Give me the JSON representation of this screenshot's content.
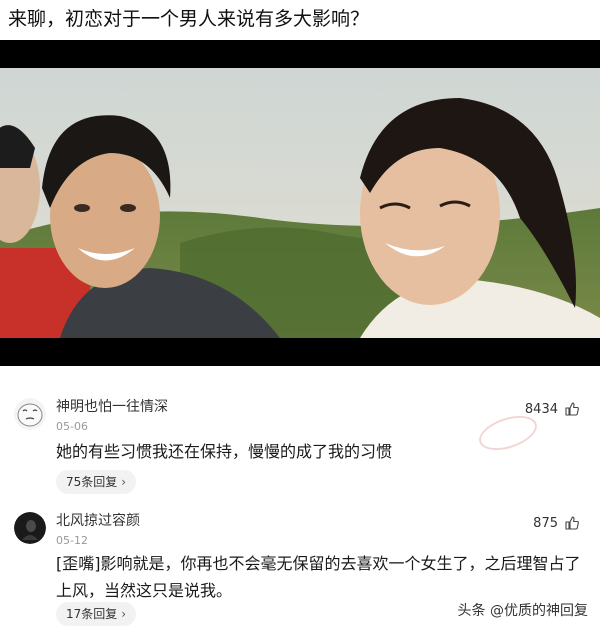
{
  "post": {
    "question": "来聊，初恋对于一个男人来说有多大影响？"
  },
  "comments": [
    {
      "username": "神明也怕一往情深",
      "date": "05-06",
      "likes": "8434",
      "text": "她的有些习惯我还在保持，慢慢的成了我的习惯",
      "replies": "75条回复",
      "avatar_icon": "meme-face-avatar"
    },
    {
      "username": "北风掠过容颜",
      "date": "05-12",
      "likes": "875",
      "text": "[歪嘴]影响就是，你再也不会毫无保留的去喜欢一个女生了，之后理智占了上风，当然这只是说我。",
      "replies": "17条回复",
      "avatar_icon": "dark-photo-avatar"
    }
  ],
  "watermark": "头条 @优质的神回复",
  "colors": {
    "background": "#ffffff",
    "text": "#1a1a1a",
    "muted": "#999999",
    "pill": "#f2f2f2",
    "video_bar": "#000000"
  }
}
